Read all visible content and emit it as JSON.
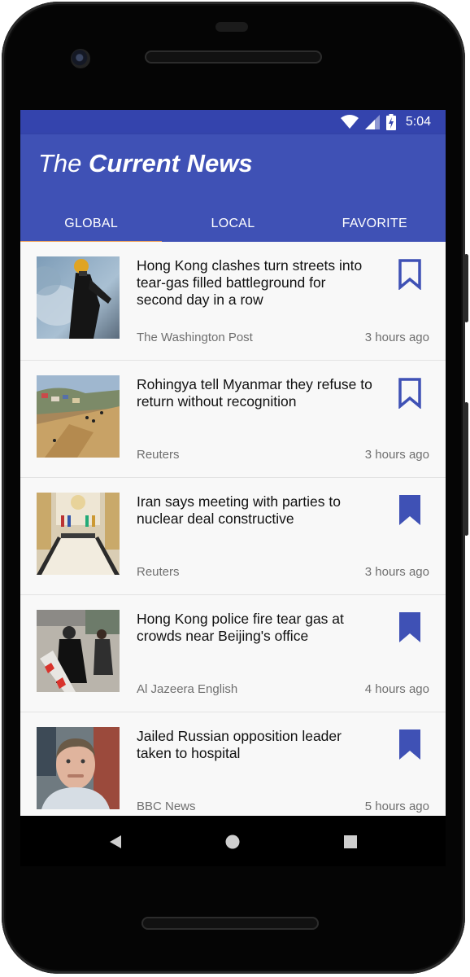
{
  "status_bar": {
    "time": "5:04"
  },
  "app": {
    "title_light": "The",
    "title_bold": "Current News",
    "header_color": "#3f51b5",
    "status_color": "#3444ad",
    "accent_color": "#f0a35a"
  },
  "tabs": [
    {
      "label": "GLOBAL",
      "selected": true
    },
    {
      "label": "LOCAL",
      "selected": false
    },
    {
      "label": "FAVORITE",
      "selected": false
    }
  ],
  "articles": [
    {
      "headline": "Hong Kong clashes turn streets into tear-gas filled battleground for second day in a row",
      "source": "The Washington Post",
      "time": "3 hours ago",
      "bookmarked": false,
      "image": "protester-tear-gas-photo"
    },
    {
      "headline": "Rohingya tell Myanmar they refuse to return without recognition",
      "source": "Reuters",
      "time": "3 hours ago",
      "bookmarked": false,
      "image": "refugee-camp-hillside-photo"
    },
    {
      "headline": "Iran says meeting with parties to nuclear deal constructive",
      "source": "Reuters",
      "time": "3 hours ago",
      "bookmarked": true,
      "image": "conference-table-meeting-photo"
    },
    {
      "headline": "Hong Kong police fire tear gas at crowds near Beijing's office",
      "source": "Al Jazeera English",
      "time": "4 hours ago",
      "bookmarked": true,
      "image": "street-protest-crowd-photo"
    },
    {
      "headline": "Jailed Russian opposition leader taken to hospital",
      "source": "BBC News",
      "time": "5 hours ago",
      "bookmarked": true,
      "image": "man-portrait-photo"
    }
  ],
  "icons": {
    "status": [
      "wifi-icon",
      "signal-icon",
      "battery-charging-icon"
    ],
    "nav": [
      "back-icon",
      "home-icon",
      "recents-icon"
    ]
  },
  "bookmark_color": "#3f51b5"
}
